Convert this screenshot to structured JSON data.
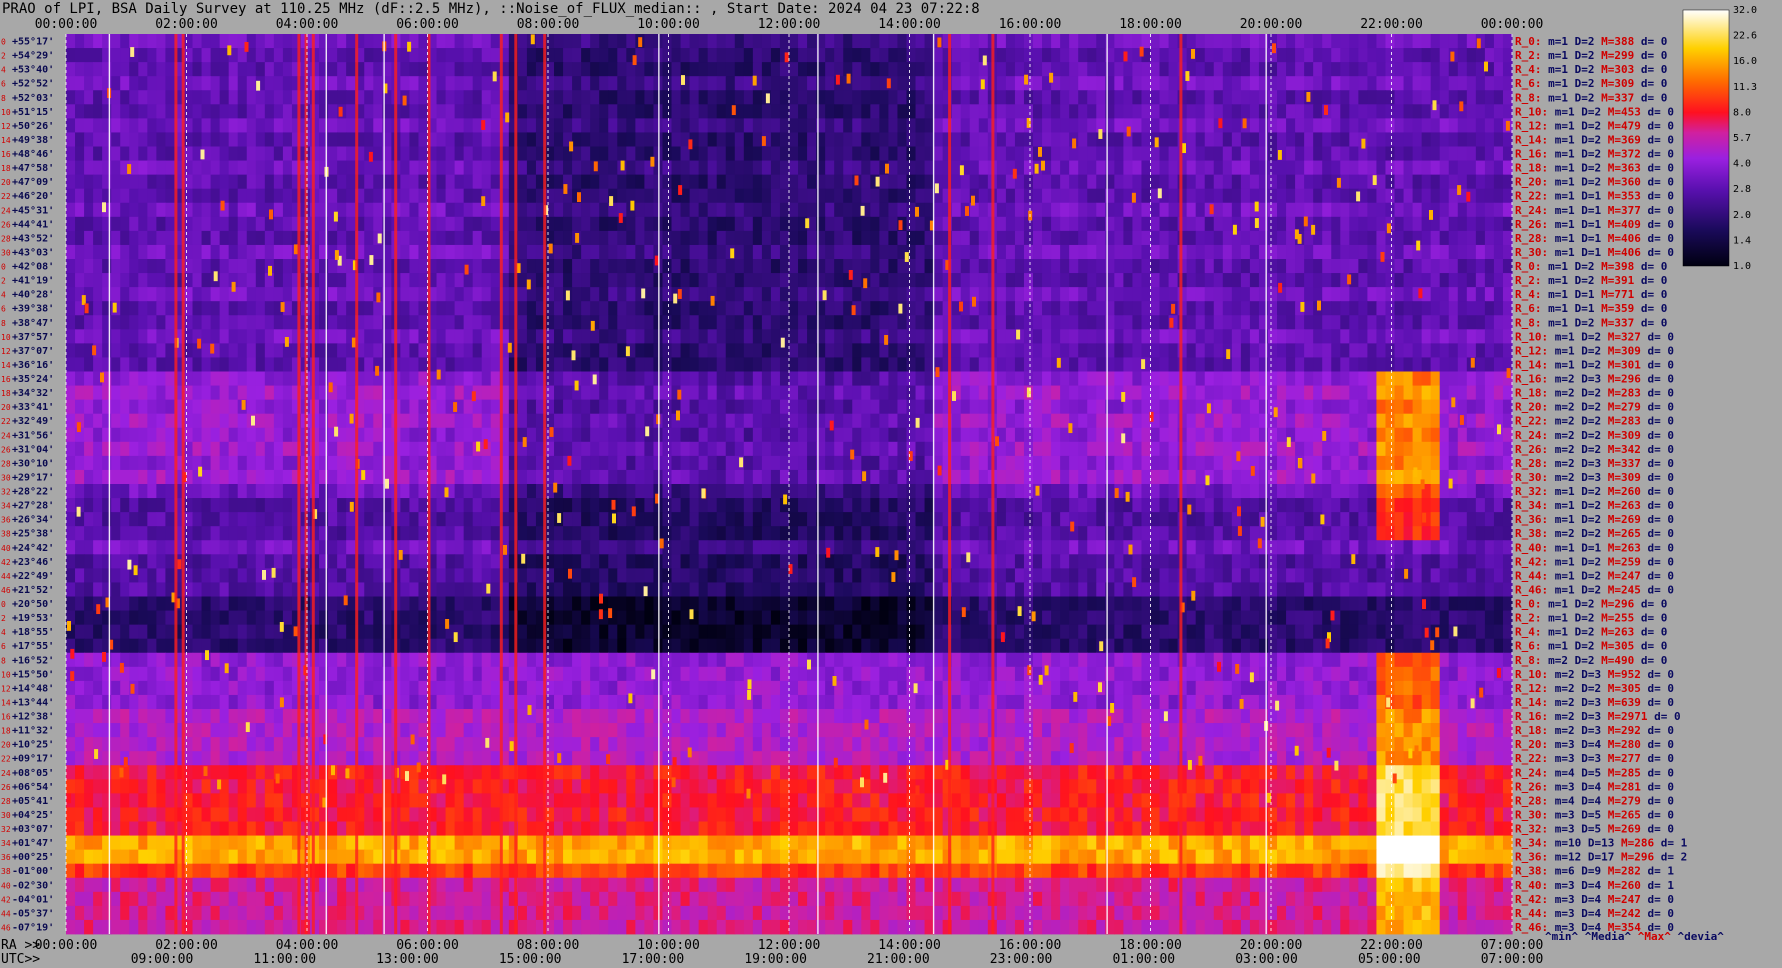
{
  "title": "PRAO of LPI, BSA Daily Survey at 110.25 MHz (dF::2.5 MHz), ::Noise_of_FLUX_median:: , Start Date: 2024 04 23 07:22:8",
  "chart_data": {
    "type": "heatmap",
    "title": "PRAO of LPI, BSA Daily Survey at 110.25 MHz (dF::2.5 MHz), ::Noise_of_FLUX_median:: , Start Date: 2024 04 23 07:22:8",
    "top_axis_ticks": [
      "00:00:00",
      "02:00:00",
      "04:00:00",
      "06:00:00",
      "08:00:00",
      "10:00:00",
      "12:00:00",
      "14:00:00",
      "16:00:00",
      "18:00:00",
      "20:00:00",
      "22:00:00",
      "00:00:00"
    ],
    "ra_axis_label": "RA >>",
    "ra_ticks": [
      "00:00:00",
      "02:00:00",
      "04:00:00",
      "06:00:00",
      "08:00:00",
      "10:00:00",
      "12:00:00",
      "14:00:00",
      "16:00:00",
      "18:00:00",
      "20:00:00",
      "22:00:00",
      "07:00:00"
    ],
    "utc_axis_label": "UTC>>",
    "utc_ticks": [
      "09:00:00",
      "11:00:00",
      "13:00:00",
      "15:00:00",
      "17:00:00",
      "19:00:00",
      "21:00:00",
      "23:00:00",
      "01:00:00",
      "03:00:00",
      "05:00:00",
      "07:00:00"
    ],
    "colorbar": {
      "ticks": [
        "32.0",
        "22.6",
        "16.0",
        "11.3",
        "8.0",
        "5.7",
        "4.0",
        "2.8",
        "2.0",
        "1.4",
        "1.0"
      ],
      "scale": "log",
      "range": [
        1.0,
        32.0
      ]
    },
    "declinations": [
      "+55°17'",
      "+54°29'",
      "+53°40'",
      "+52°52'",
      "+52°03'",
      "+51°15'",
      "+50°26'",
      "+49°38'",
      "+48°46'",
      "+47°58'",
      "+47°09'",
      "+46°20'",
      "+45°31'",
      "+44°41'",
      "+43°52'",
      "+43°03'",
      "+42°08'",
      "+41°19'",
      "+40°28'",
      "+39°38'",
      "+38°47'",
      "+37°57'",
      "+37°07'",
      "+36°16'",
      "+35°24'",
      "+34°32'",
      "+33°41'",
      "+32°49'",
      "+31°56'",
      "+31°04'",
      "+30°10'",
      "+29°17'",
      "+28°22'",
      "+27°28'",
      "+26°34'",
      "+25°38'",
      "+24°42'",
      "+23°46'",
      "+22°49'",
      "+21°52'",
      "+20°50'",
      "+19°53'",
      "+18°55'",
      "+17°55'",
      "+16°52'",
      "+15°50'",
      "+14°48'",
      "+13°44'",
      "+12°38'",
      "+11°32'",
      "+10°25'",
      "+09°17'",
      "+08°05'",
      "+06°54'",
      "+05°41'",
      "+04°25'",
      "+03°07'",
      "+01°47'",
      "+00°25'",
      "-01°00'",
      "-02°30'",
      "-04°01'",
      "-05°37'",
      "-07°19'"
    ],
    "channel_numbers": [
      "0",
      "2",
      "4",
      "6",
      "8",
      "10",
      "12",
      "14",
      "16",
      "18",
      "20",
      "22",
      "24",
      "26",
      "28",
      "30",
      "0",
      "2",
      "4",
      "6",
      "8",
      "10",
      "12",
      "14",
      "16",
      "18",
      "20",
      "22",
      "24",
      "26",
      "28",
      "30",
      "32",
      "34",
      "36",
      "38",
      "40",
      "42",
      "44",
      "46",
      "0",
      "2",
      "4",
      "6",
      "8",
      "10",
      "12",
      "14",
      "16",
      "18",
      "20",
      "22",
      "24",
      "26",
      "28",
      "30",
      "32",
      "34",
      "36",
      "38",
      "40",
      "42",
      "44",
      "46"
    ],
    "row_stats": [
      {
        "r": "R_0:",
        "m": "m=1",
        "d": "D=2",
        "M": "M=388",
        "dd": "d= 0"
      },
      {
        "r": "R_2:",
        "m": "m=1",
        "d": "D=2",
        "M": "M=299",
        "dd": "d= 0"
      },
      {
        "r": "R_4:",
        "m": "m=1",
        "d": "D=2",
        "M": "M=303",
        "dd": "d= 0"
      },
      {
        "r": "R_6:",
        "m": "m=1",
        "d": "D=2",
        "M": "M=309",
        "dd": "d= 0"
      },
      {
        "r": "R_8:",
        "m": "m=1",
        "d": "D=2",
        "M": "M=337",
        "dd": "d= 0"
      },
      {
        "r": "R_10:",
        "m": "m=1",
        "d": "D=2",
        "M": "M=453",
        "dd": "d= 0"
      },
      {
        "r": "R_12:",
        "m": "m=1",
        "d": "D=2",
        "M": "M=479",
        "dd": "d= 0"
      },
      {
        "r": "R_14:",
        "m": "m=1",
        "d": "D=2",
        "M": "M=369",
        "dd": "d= 0"
      },
      {
        "r": "R_16:",
        "m": "m=1",
        "d": "D=2",
        "M": "M=372",
        "dd": "d= 0"
      },
      {
        "r": "R_18:",
        "m": "m=1",
        "d": "D=2",
        "M": "M=363",
        "dd": "d= 0"
      },
      {
        "r": "R_20:",
        "m": "m=1",
        "d": "D=2",
        "M": "M=360",
        "dd": "d= 0"
      },
      {
        "r": "R_22:",
        "m": "m=1",
        "d": "D=1",
        "M": "M=353",
        "dd": "d= 0"
      },
      {
        "r": "R_24:",
        "m": "m=1",
        "d": "D=1",
        "M": "M=377",
        "dd": "d= 0"
      },
      {
        "r": "R_26:",
        "m": "m=1",
        "d": "D=1",
        "M": "M=409",
        "dd": "d= 0"
      },
      {
        "r": "R_28:",
        "m": "m=1",
        "d": "D=1",
        "M": "M=406",
        "dd": "d= 0"
      },
      {
        "r": "R_30:",
        "m": "m=1",
        "d": "D=1",
        "M": "M=406",
        "dd": "d= 0"
      },
      {
        "r": "R_0:",
        "m": "m=1",
        "d": "D=2",
        "M": "M=398",
        "dd": "d= 0"
      },
      {
        "r": "R_2:",
        "m": "m=1",
        "d": "D=2",
        "M": "M=391",
        "dd": "d= 0"
      },
      {
        "r": "R_4:",
        "m": "m=1",
        "d": "D=1",
        "M": "M=771",
        "dd": "d= 0"
      },
      {
        "r": "R_6:",
        "m": "m=1",
        "d": "D=1",
        "M": "M=359",
        "dd": "d= 0"
      },
      {
        "r": "R_8:",
        "m": "m=1",
        "d": "D=2",
        "M": "M=337",
        "dd": "d= 0"
      },
      {
        "r": "R_10:",
        "m": "m=1",
        "d": "D=2",
        "M": "M=327",
        "dd": "d= 0"
      },
      {
        "r": "R_12:",
        "m": "m=1",
        "d": "D=2",
        "M": "M=309",
        "dd": "d= 0"
      },
      {
        "r": "R_14:",
        "m": "m=1",
        "d": "D=2",
        "M": "M=301",
        "dd": "d= 0"
      },
      {
        "r": "R_16:",
        "m": "m=2",
        "d": "D=3",
        "M": "M=296",
        "dd": "d= 0"
      },
      {
        "r": "R_18:",
        "m": "m=2",
        "d": "D=2",
        "M": "M=283",
        "dd": "d= 0"
      },
      {
        "r": "R_20:",
        "m": "m=2",
        "d": "D=2",
        "M": "M=279",
        "dd": "d= 0"
      },
      {
        "r": "R_22:",
        "m": "m=2",
        "d": "D=2",
        "M": "M=283",
        "dd": "d= 0"
      },
      {
        "r": "R_24:",
        "m": "m=2",
        "d": "D=2",
        "M": "M=309",
        "dd": "d= 0"
      },
      {
        "r": "R_26:",
        "m": "m=2",
        "d": "D=2",
        "M": "M=342",
        "dd": "d= 0"
      },
      {
        "r": "R_28:",
        "m": "m=2",
        "d": "D=3",
        "M": "M=337",
        "dd": "d= 0"
      },
      {
        "r": "R_30:",
        "m": "m=2",
        "d": "D=3",
        "M": "M=309",
        "dd": "d= 0"
      },
      {
        "r": "R_32:",
        "m": "m=1",
        "d": "D=2",
        "M": "M=260",
        "dd": "d= 0"
      },
      {
        "r": "R_34:",
        "m": "m=1",
        "d": "D=2",
        "M": "M=263",
        "dd": "d= 0"
      },
      {
        "r": "R_36:",
        "m": "m=1",
        "d": "D=2",
        "M": "M=269",
        "dd": "d= 0"
      },
      {
        "r": "R_38:",
        "m": "m=2",
        "d": "D=2",
        "M": "M=265",
        "dd": "d= 0"
      },
      {
        "r": "R_40:",
        "m": "m=1",
        "d": "D=1",
        "M": "M=263",
        "dd": "d= 0"
      },
      {
        "r": "R_42:",
        "m": "m=1",
        "d": "D=2",
        "M": "M=259",
        "dd": "d= 0"
      },
      {
        "r": "R_44:",
        "m": "m=1",
        "d": "D=2",
        "M": "M=247",
        "dd": "d= 0"
      },
      {
        "r": "R_46:",
        "m": "m=1",
        "d": "D=2",
        "M": "M=245",
        "dd": "d= 0"
      },
      {
        "r": "R_0:",
        "m": "m=1",
        "d": "D=2",
        "M": "M=296",
        "dd": "d= 0"
      },
      {
        "r": "R_2:",
        "m": "m=1",
        "d": "D=2",
        "M": "M=255",
        "dd": "d= 0"
      },
      {
        "r": "R_4:",
        "m": "m=1",
        "d": "D=2",
        "M": "M=263",
        "dd": "d= 0"
      },
      {
        "r": "R_6:",
        "m": "m=1",
        "d": "D=2",
        "M": "M=305",
        "dd": "d= 0"
      },
      {
        "r": "R_8:",
        "m": "m=2",
        "d": "D=2",
        "M": "M=490",
        "dd": "d= 0"
      },
      {
        "r": "R_10:",
        "m": "m=2",
        "d": "D=3",
        "M": "M=952",
        "dd": "d= 0"
      },
      {
        "r": "R_12:",
        "m": "m=2",
        "d": "D=2",
        "M": "M=305",
        "dd": "d= 0"
      },
      {
        "r": "R_14:",
        "m": "m=2",
        "d": "D=3",
        "M": "M=639",
        "dd": "d= 0"
      },
      {
        "r": "R_16:",
        "m": "m=2",
        "d": "D=3",
        "M": "M=2971",
        "dd": "d= 0"
      },
      {
        "r": "R_18:",
        "m": "m=2",
        "d": "D=3",
        "M": "M=292",
        "dd": "d= 0"
      },
      {
        "r": "R_20:",
        "m": "m=3",
        "d": "D=4",
        "M": "M=280",
        "dd": "d= 0"
      },
      {
        "r": "R_22:",
        "m": "m=3",
        "d": "D=3",
        "M": "M=277",
        "dd": "d= 0"
      },
      {
        "r": "R_24:",
        "m": "m=4",
        "d": "D=5",
        "M": "M=285",
        "dd": "d= 0"
      },
      {
        "r": "R_26:",
        "m": "m=3",
        "d": "D=4",
        "M": "M=281",
        "dd": "d= 0"
      },
      {
        "r": "R_28:",
        "m": "m=4",
        "d": "D=4",
        "M": "M=279",
        "dd": "d= 0"
      },
      {
        "r": "R_30:",
        "m": "m=3",
        "d": "D=5",
        "M": "M=265",
        "dd": "d= 0"
      },
      {
        "r": "R_32:",
        "m": "m=3",
        "d": "D=5",
        "M": "M=269",
        "dd": "d= 0"
      },
      {
        "r": "R_34:",
        "m": "m=10",
        "d": "D=13",
        "M": "M=286",
        "dd": "d= 1"
      },
      {
        "r": "R_36:",
        "m": "m=12",
        "d": "D=17",
        "M": "M=296",
        "dd": "d= 2"
      },
      {
        "r": "R_38:",
        "m": "m=6",
        "d": "D=9",
        "M": "M=282",
        "dd": "d= 1"
      },
      {
        "r": "R_40:",
        "m": "m=3",
        "d": "D=4",
        "M": "M=260",
        "dd": "d= 1"
      },
      {
        "r": "R_42:",
        "m": "m=3",
        "d": "D=4",
        "M": "M=247",
        "dd": "d= 0"
      },
      {
        "r": "R_44:",
        "m": "m=3",
        "d": "D=4",
        "M": "M=242",
        "dd": "d= 0"
      },
      {
        "r": "R_46:",
        "m": "m=3",
        "d": "D=4",
        "M": "M=354",
        "dd": "d= 0"
      }
    ],
    "stats_legend": [
      "^min^",
      "^Media^",
      "^Max^",
      "^devia^"
    ]
  },
  "colors": {
    "background": "#a8a8a8",
    "stat_red": "#d00000",
    "stat_navy": "#0a0a60"
  }
}
